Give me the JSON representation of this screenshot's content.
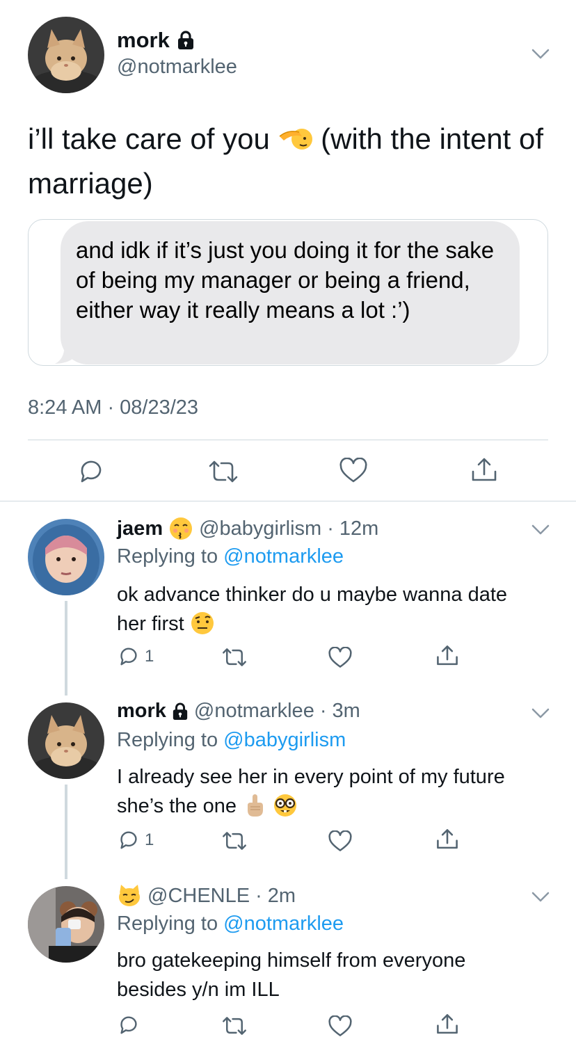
{
  "main_tweet": {
    "name": "mork",
    "handle": "@notmarklee",
    "text_part1": "i’ll take care of you ",
    "text_part2": " (with the intent of marriage)",
    "quote_text": "and idk if it’s just you doing it for the sake of being my manager or being a friend, either way it really means a lot :’)",
    "timestamp": "8:24 AM · 08/23/23"
  },
  "replies": [
    {
      "name": "jaem",
      "handle": "@babygirlism",
      "time": "12m",
      "replying_prefix": "Replying to ",
      "replying_to": "@notmarklee",
      "text": "ok advance thinker do u maybe wanna date her first ",
      "reply_count": "1"
    },
    {
      "name": "mork",
      "handle": "@notmarklee",
      "time": "3m",
      "replying_prefix": "Replying to ",
      "replying_to": "@babygirlism",
      "text": "I already see her in every point of my future she’s the one ",
      "reply_count": "1"
    },
    {
      "name": "",
      "handle": "@CHENLE",
      "time": "2m",
      "replying_prefix": "Replying to ",
      "replying_to": "@notmarklee",
      "text": "bro gatekeeping himself from everyone besides y/n im ILL",
      "reply_count": ""
    }
  ],
  "colors": {
    "link": "#1d9bf0",
    "secondary_text": "#536471",
    "divider": "#cfd9de",
    "bubble": "#e9e9eb"
  },
  "icons": [
    "lock-icon",
    "chevron-down-icon",
    "reply-icon",
    "retweet-icon",
    "like-icon",
    "share-icon"
  ]
}
